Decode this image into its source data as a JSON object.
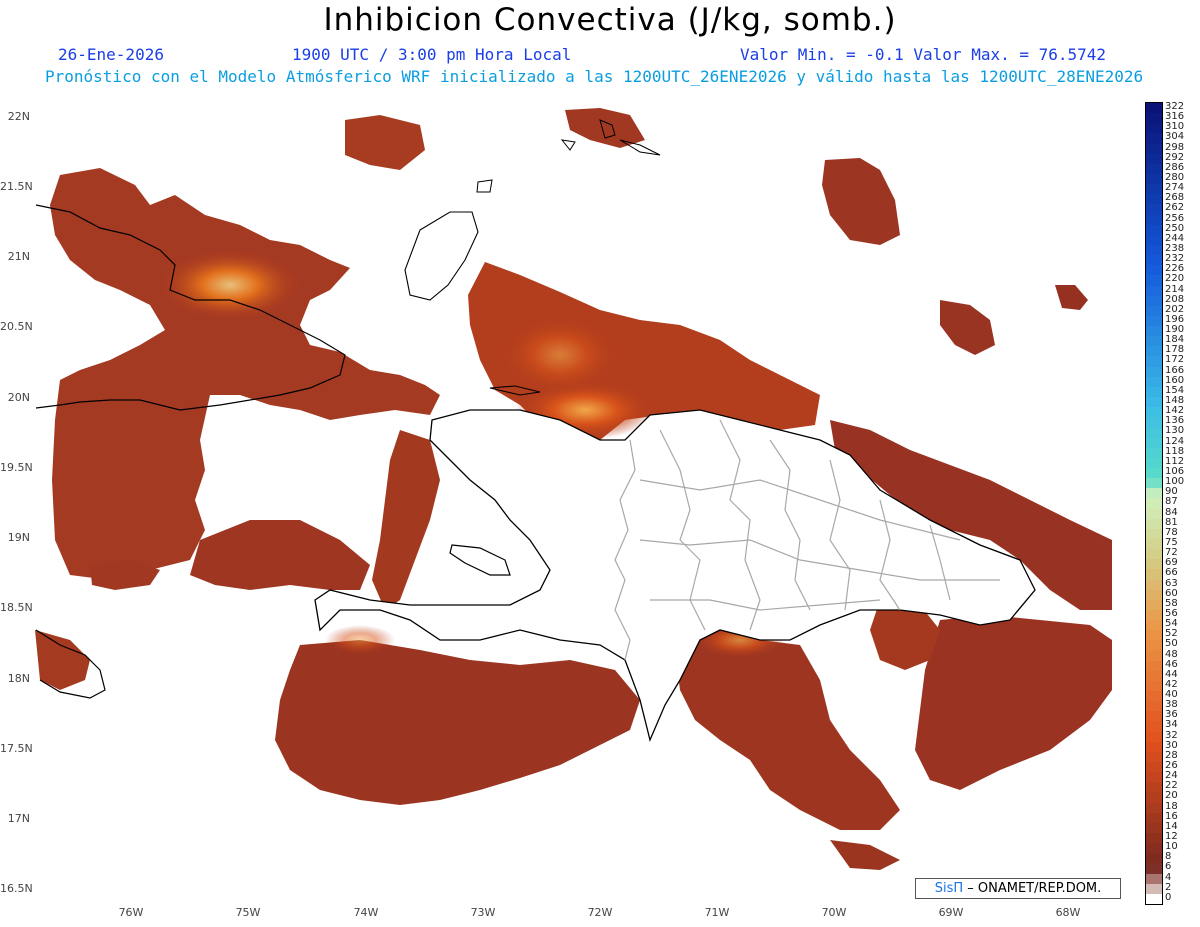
{
  "header": {
    "title": "Inhibicion Convectiva (J/kg, somb.)",
    "date": "26-Ene-2026",
    "time": "1900 UTC / 3:00 pm Hora Local",
    "minmax": "Valor Min. = -0.1  Valor Max. = 76.5742",
    "forecast": "Pronóstico con el Modelo Atmósferico WRF inicializado a las 1200UTC_26ENE2026 y válido hasta las  1200UTC_28ENE2026"
  },
  "axes": {
    "lat_labels": [
      "22N",
      "21.5N",
      "21N",
      "20.5N",
      "20N",
      "19.5N",
      "19N",
      "18.5N",
      "18N",
      "17.5N",
      "17N",
      "16.5N"
    ],
    "lon_labels": [
      "76W",
      "75W",
      "74W",
      "73W",
      "72W",
      "71W",
      "70W",
      "69W",
      "68W"
    ]
  },
  "colorbar": {
    "labels": [
      "322",
      "316",
      "310",
      "304",
      "298",
      "292",
      "286",
      "280",
      "274",
      "268",
      "262",
      "256",
      "250",
      "244",
      "238",
      "232",
      "226",
      "220",
      "214",
      "208",
      "202",
      "196",
      "190",
      "184",
      "178",
      "172",
      "166",
      "160",
      "154",
      "148",
      "142",
      "136",
      "130",
      "124",
      "118",
      "112",
      "106",
      "100",
      "90",
      "87",
      "84",
      "81",
      "78",
      "75",
      "72",
      "69",
      "66",
      "63",
      "60",
      "58",
      "56",
      "54",
      "52",
      "50",
      "48",
      "46",
      "44",
      "42",
      "40",
      "38",
      "36",
      "34",
      "32",
      "30",
      "28",
      "26",
      "24",
      "22",
      "20",
      "18",
      "16",
      "14",
      "12",
      "10",
      "8",
      "6",
      "4",
      "2",
      "0"
    ]
  },
  "credit": {
    "brand": "SisΠ",
    "org": "– ONAMET/REP.DOM."
  },
  "colors": {
    "field_low": "#8b3322",
    "field_mid": "#c9461a",
    "field_high": "#e8a574",
    "border": "#000000",
    "provinces": "#a8a8a8",
    "sub_blue": "#1a3ee8",
    "sub_cyan": "#0a9ee0"
  }
}
